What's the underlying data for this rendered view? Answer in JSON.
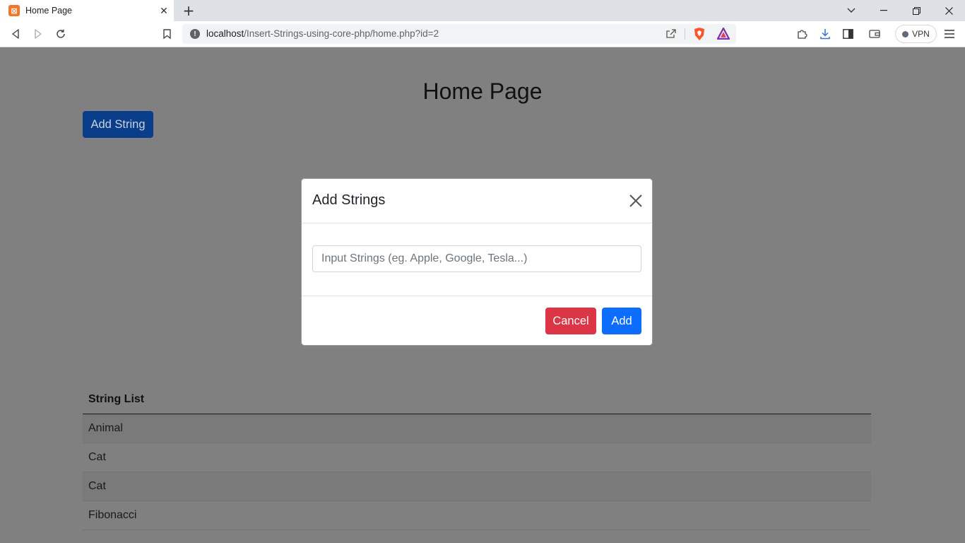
{
  "browser": {
    "tab_title": "Home Page",
    "favicon_glyph": "⌘",
    "new_tab_glyph": "+",
    "url_host": "localhost",
    "url_path": "/Insert-Strings-using-core-php/home.php?id=2",
    "vpn_label": "VPN"
  },
  "page": {
    "title": "Home Page",
    "add_string_button": "Add String"
  },
  "modal": {
    "title": "Add Strings",
    "input_placeholder": "Input Strings (eg. Apple, Google, Tesla...)",
    "input_value": "",
    "cancel_label": "Cancel",
    "add_label": "Add"
  },
  "string_list": {
    "header": "String List",
    "items": [
      "Animal",
      "Cat",
      "Cat",
      "Fibonacci"
    ]
  },
  "colors": {
    "backdrop": "#808080",
    "primary": "#0d6efd",
    "danger": "#dc3545",
    "favicon": "#f0772b",
    "brave": "#fb542b"
  }
}
